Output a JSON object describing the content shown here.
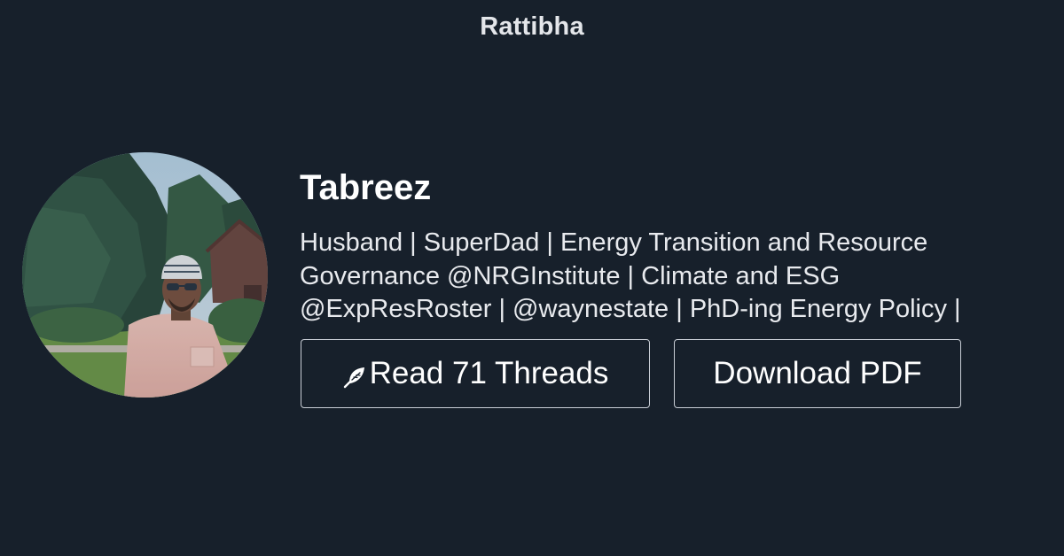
{
  "brand": {
    "title": "Rattibha"
  },
  "profile": {
    "name": "Tabreez",
    "bio": "Husband | SuperDad | Energy Transition and Resource Governance @NRGInstitute | Climate and ESG @ExpResRoster | @waynestate | PhD-ing Energy Policy |",
    "avatar_icon": "profile-photo"
  },
  "actions": {
    "read_icon": "feather-icon",
    "read_label": "Read 71 Threads",
    "pdf_label": "Download PDF"
  },
  "colors": {
    "background": "#17202b",
    "text": "#ffffff",
    "border": "#c9ced6"
  }
}
